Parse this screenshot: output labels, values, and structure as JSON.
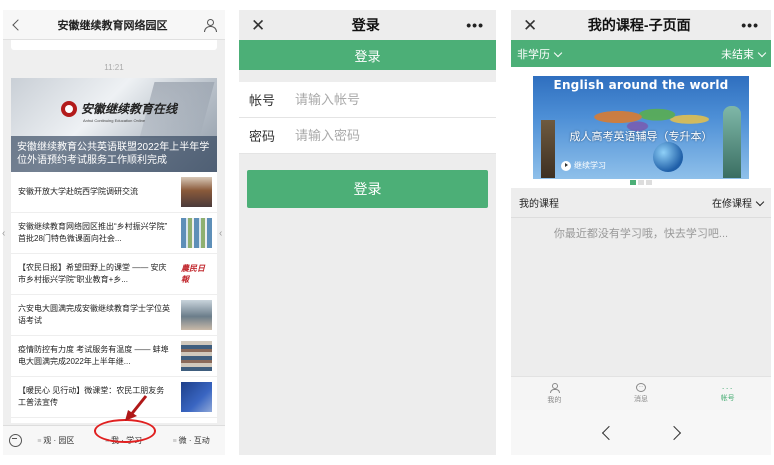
{
  "panel1": {
    "header_title": "安徽继续教育网络园区",
    "time": "11:21",
    "banner": {
      "logo_text": "安徽继续教育在线",
      "logo_sub": "Anhui Continuing Education Online",
      "caption": "安徽继续教育公共英语联盟2022年上半年学位外语预约考试服务工作顺利完成"
    },
    "news": [
      {
        "text": "安徽开放大学赴皖西学院调研交流"
      },
      {
        "text": "安徽继续教育网络园区推出“乡村振兴学院” 首批28门特色微课面向社会..."
      },
      {
        "text": "【农民日报】希望田野上的课堂 —— 安庆市乡村振兴学院“职业教育+乡..."
      },
      {
        "text": "六安电大圆满完成安徽继续教育学士学位英语考试"
      },
      {
        "text": "疫情防控有力度 考试服务有温度 —— 蚌埠电大圆满完成2022年上半年继..."
      },
      {
        "text": "【暖民心 见行动】微课堂：农民工朋友务工普法宣传"
      }
    ],
    "thumb_newspaper": "農民日報",
    "tabs": [
      "观 · 园区",
      "我 · 学习",
      "微 · 互动"
    ]
  },
  "panel2": {
    "header_title": "登录",
    "more": "•••",
    "close": "✕",
    "banner_label": "登录",
    "account_label": "帐号",
    "account_placeholder": "请输入帐号",
    "password_label": "密码",
    "password_placeholder": "请输入密码",
    "login_button": "登录"
  },
  "panel3": {
    "header_title": "我的课程-子页面",
    "more": "•••",
    "close": "✕",
    "filter_left": "非学历",
    "filter_right": "未结束",
    "banner_title": "English around the world",
    "course_name": "成人高考英语辅导（专升本）",
    "continue_label": "继续学习",
    "my_courses": "我的课程",
    "course_status": "在修课程",
    "empty_text": "你最近都没有学习哦，快去学习吧...",
    "tabs": [
      {
        "label": "我的",
        "icon": "user-icon"
      },
      {
        "label": "消息",
        "icon": "message-icon"
      },
      {
        "label": "帐号",
        "icon": "more-icon"
      }
    ]
  },
  "colors": {
    "accent_green": "#4caf77",
    "highlight_red": "#e02020"
  }
}
